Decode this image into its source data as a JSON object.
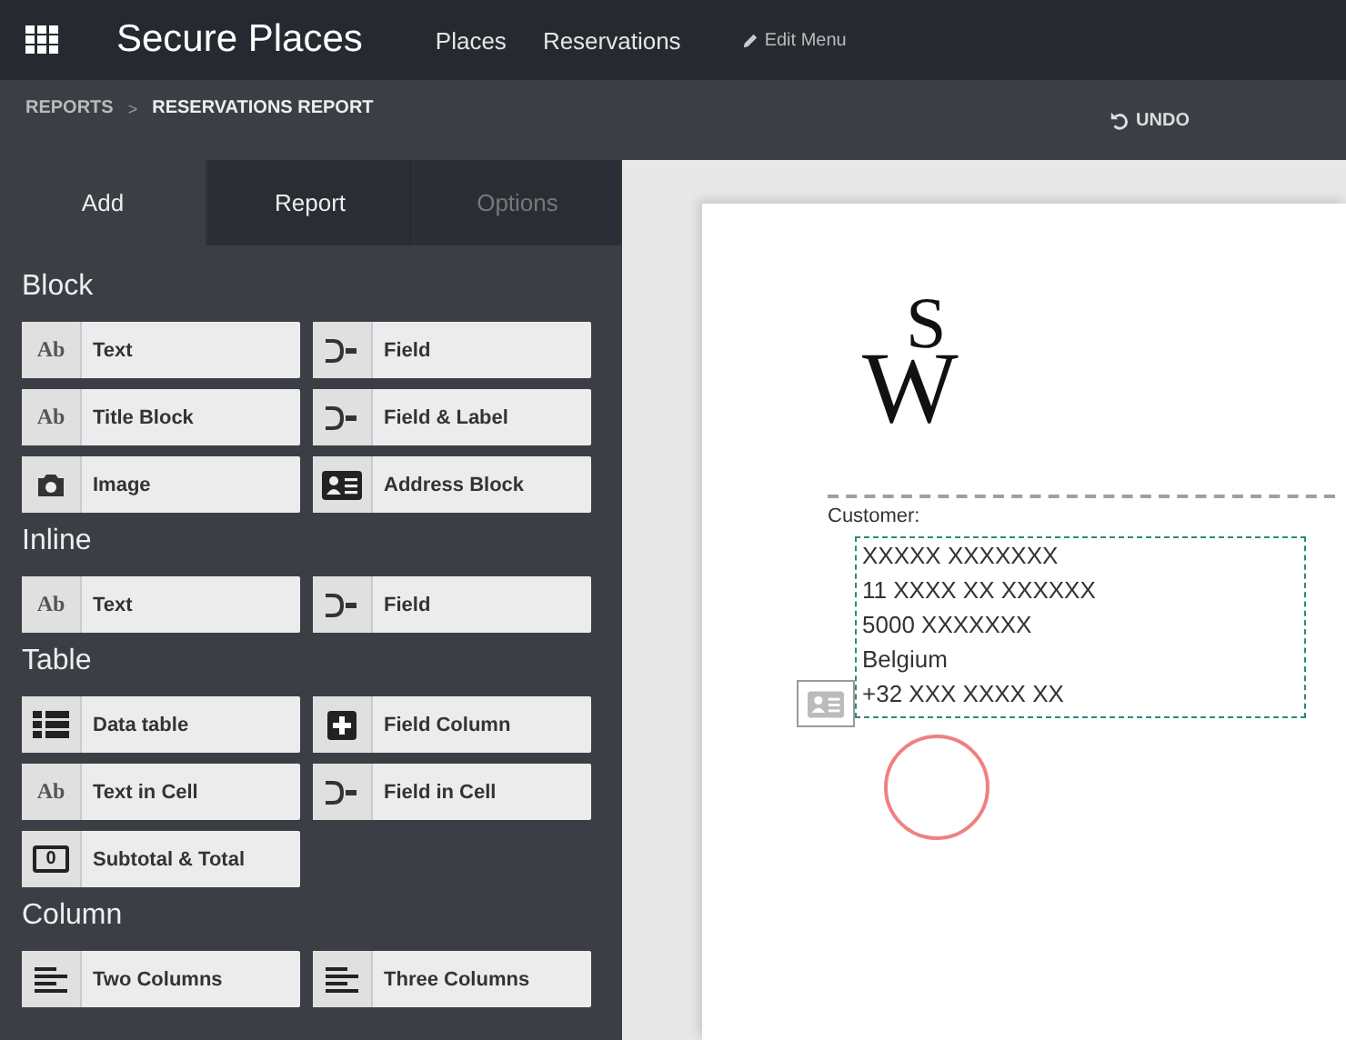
{
  "app_bar": {
    "title": "Secure Places",
    "nav": [
      {
        "label": "Places"
      },
      {
        "label": "Reservations"
      }
    ],
    "edit_menu": "Edit Menu"
  },
  "breadcrumb": {
    "items": [
      "REPORTS",
      "RESERVATIONS REPORT"
    ],
    "separator": ">",
    "undo": "UNDO"
  },
  "tabs": [
    {
      "label": "Add",
      "selected": true,
      "disabled": false
    },
    {
      "label": "Report",
      "selected": false,
      "disabled": false
    },
    {
      "label": "Options",
      "selected": false,
      "disabled": true
    }
  ],
  "sections": [
    {
      "title": "Block",
      "items": [
        {
          "label": "Text",
          "kind": "ab",
          "icon_label": "Ab"
        },
        {
          "label": "Field",
          "kind": "field"
        },
        {
          "label": "Title Block",
          "kind": "ab",
          "icon_label": "Ab"
        },
        {
          "label": "Field & Label",
          "kind": "field"
        },
        {
          "label": "Image",
          "kind": "camera"
        },
        {
          "label": "Address Block",
          "kind": "address"
        }
      ]
    },
    {
      "title": "Inline",
      "items": [
        {
          "label": "Text",
          "kind": "ab",
          "icon_label": "Ab"
        },
        {
          "label": "Field",
          "kind": "field"
        }
      ]
    },
    {
      "title": "Table",
      "items": [
        {
          "label": "Data table",
          "kind": "list"
        },
        {
          "label": "Field Column",
          "kind": "plus"
        },
        {
          "label": "Text in Cell",
          "kind": "ab",
          "icon_label": "Ab"
        },
        {
          "label": "Field in Cell",
          "kind": "field"
        },
        {
          "label": "Subtotal & Total",
          "kind": "money",
          "icon_label": "0"
        }
      ]
    },
    {
      "title": "Column",
      "items": [
        {
          "label": "Two Columns",
          "kind": "lines"
        },
        {
          "label": "Three Columns",
          "kind": "lines"
        }
      ]
    }
  ],
  "report_page": {
    "logo": [
      "S",
      "W"
    ],
    "customer_label": "Customer:",
    "address_lines": [
      "XXXXX XXXXXXX",
      "11 XXXX XX XXXXXX",
      "5000 XXXXXXX",
      "Belgium",
      "+32 XXX XXXX XX"
    ]
  }
}
